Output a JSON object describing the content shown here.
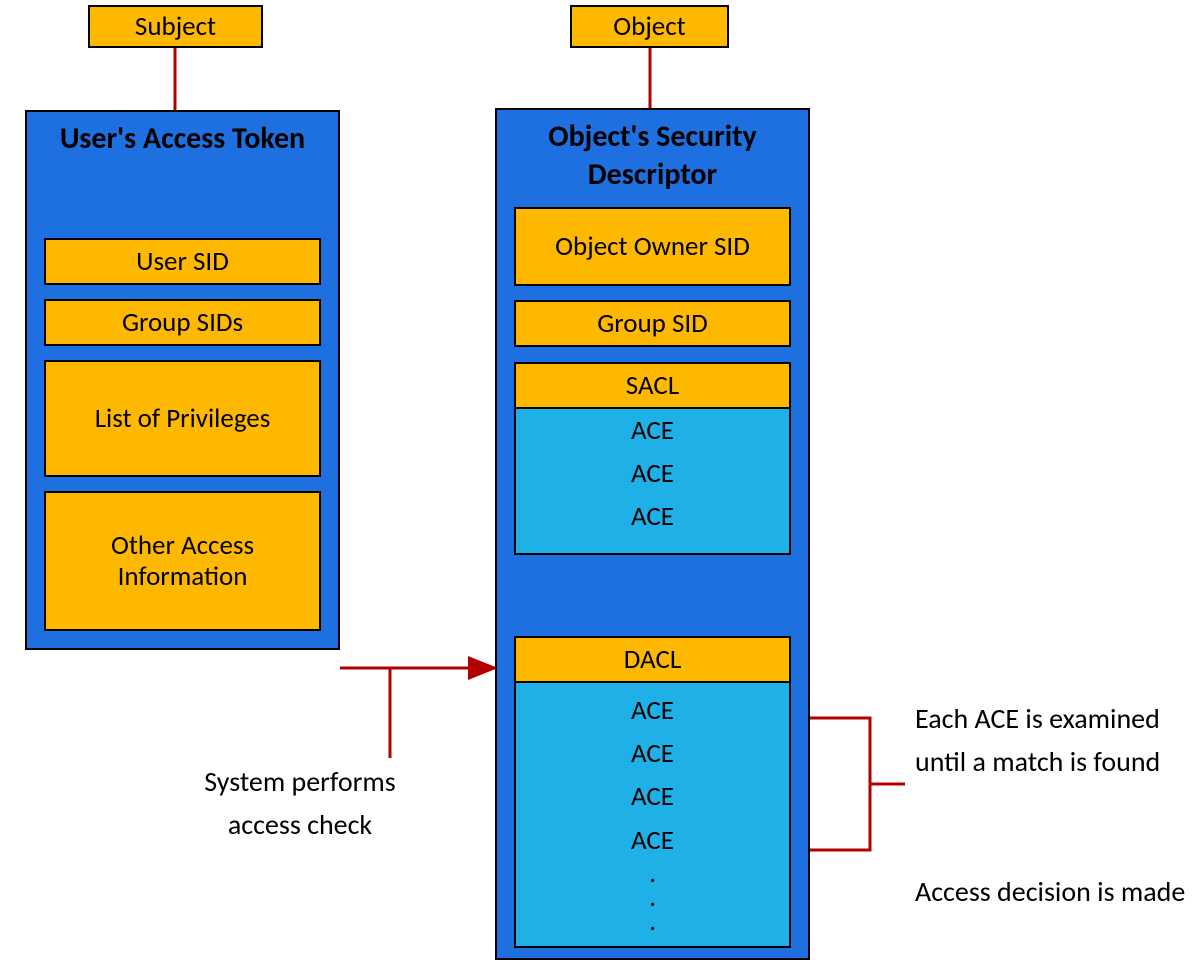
{
  "top": {
    "subject": "Subject",
    "object": "Object"
  },
  "left": {
    "title": "User's Access Token",
    "items": {
      "user_sid": "User SID",
      "group_sids": "Group SIDs",
      "privileges": "List of Privileges",
      "other": "Other Access Information"
    }
  },
  "right": {
    "title": "Object's Security Descriptor",
    "items": {
      "owner_sid": "Object Owner SID",
      "group_sid": "Group SID",
      "sacl_header": "SACL",
      "sacl_entries": [
        "ACE",
        "ACE",
        "ACE"
      ],
      "dacl_header": "DACL",
      "dacl_entries": [
        "ACE",
        "ACE",
        "ACE",
        "ACE",
        ".",
        ".",
        "."
      ]
    }
  },
  "annotations": {
    "system_check": "System performs access check",
    "each_ace": "Each ACE is examined until a match is found",
    "decision": "Access decision is made"
  },
  "colors": {
    "orange": "#FFB800",
    "blue": "#1E6FE0",
    "lightblue": "#1FB0E8",
    "arrow": "#B20000"
  }
}
